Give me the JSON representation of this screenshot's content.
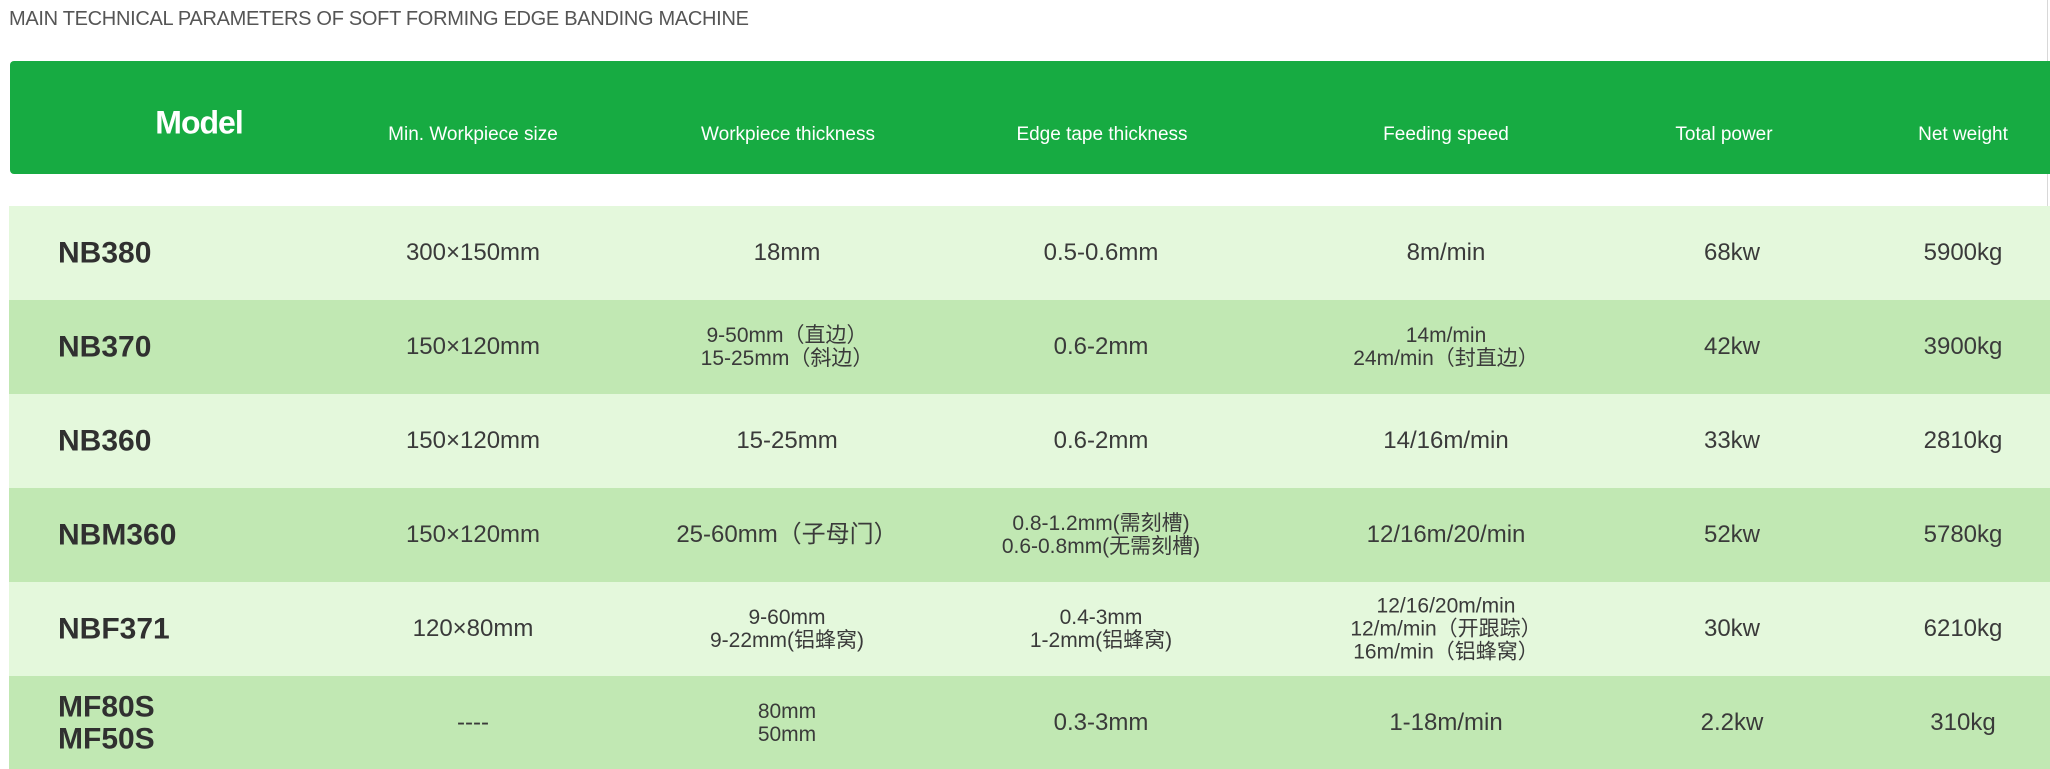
{
  "document_title": "MAIN TECHNICAL PARAMETERS OF SOFT FORMING EDGE BANDING MACHINE",
  "header": {
    "model": "Model",
    "min_size": "Min. Workpiece size",
    "thickness": "Workpiece thickness",
    "edge_tape": "Edge tape thickness",
    "feeding": "Feeding speed",
    "power": "Total power",
    "weight": "Net weight"
  },
  "rows": [
    {
      "model": [
        "NB380"
      ],
      "min_size": [
        "300×150mm"
      ],
      "thickness": [
        "18mm"
      ],
      "edge_tape": [
        "0.5-0.6mm"
      ],
      "feeding": [
        "8m/min"
      ],
      "power": [
        "68kw"
      ],
      "weight": [
        "5900kg"
      ]
    },
    {
      "model": [
        "NB370"
      ],
      "min_size": [
        "150×120mm"
      ],
      "thickness": [
        "9-50mm（直边）",
        "15-25mm（斜边）"
      ],
      "edge_tape": [
        "0.6-2mm"
      ],
      "feeding": [
        "14m/min",
        "24m/min（封直边）"
      ],
      "power": [
        "42kw"
      ],
      "weight": [
        "3900kg"
      ]
    },
    {
      "model": [
        "NB360"
      ],
      "min_size": [
        "150×120mm"
      ],
      "thickness": [
        "15-25mm"
      ],
      "edge_tape": [
        "0.6-2mm"
      ],
      "feeding": [
        "14/16m/min"
      ],
      "power": [
        "33kw"
      ],
      "weight": [
        "2810kg"
      ]
    },
    {
      "model": [
        "NBM360"
      ],
      "min_size": [
        "150×120mm"
      ],
      "thickness": [
        "25-60mm（子母门）"
      ],
      "edge_tape": [
        "0.8-1.2mm(需刻槽)",
        "0.6-0.8mm(无需刻槽)"
      ],
      "feeding": [
        "12/16m/20/min"
      ],
      "power": [
        "52kw"
      ],
      "weight": [
        "5780kg"
      ]
    },
    {
      "model": [
        "NBF371"
      ],
      "min_size": [
        "120×80mm"
      ],
      "thickness": [
        "9-60mm",
        "9-22mm(铝蜂窝)"
      ],
      "edge_tape": [
        "0.4-3mm",
        "1-2mm(铝蜂窝)"
      ],
      "feeding": [
        "12/16/20m/min",
        "12/m/min（开跟踪）",
        "16m/min（铝蜂窝）"
      ],
      "power": [
        "30kw"
      ],
      "weight": [
        "6210kg"
      ]
    },
    {
      "model": [
        "MF80S",
        "MF50S"
      ],
      "min_size": [
        "----"
      ],
      "thickness": [
        "80mm",
        "50mm"
      ],
      "edge_tape": [
        "0.3-3mm"
      ],
      "feeding": [
        "1-18m/min"
      ],
      "power": [
        "2.2kw"
      ],
      "weight": [
        "310kg"
      ]
    }
  ],
  "colors": {
    "header_bg": "#17ab42",
    "row_light": "#e4f8dc",
    "row_dark": "#c1e8b3",
    "title_text": "#555555"
  }
}
